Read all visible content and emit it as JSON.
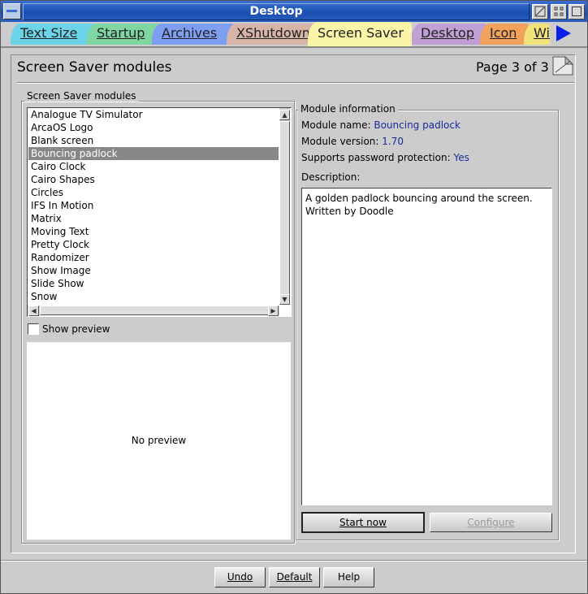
{
  "window": {
    "title": "Desktop"
  },
  "tabs": [
    {
      "label": "Text Size",
      "color": "#6bd4e8"
    },
    {
      "label": "Startup",
      "color": "#7fd6a2"
    },
    {
      "label": "Archives",
      "color": "#7e9ef2"
    },
    {
      "label": "XShutdown",
      "color": "#d8b4a8"
    },
    {
      "label": "Screen Saver",
      "color": "#fbf5a8"
    },
    {
      "label": "Desktop",
      "color": "#c0a0d4"
    },
    {
      "label": "Icon",
      "color": "#f2a25a"
    },
    {
      "label": "Wi",
      "color": "#f2e27a"
    }
  ],
  "page": {
    "title": "Screen Saver modules",
    "page_indicator": "Page 3 of 3"
  },
  "modules_group": {
    "label": "Screen Saver modules",
    "items": [
      "Analogue TV Simulator",
      "ArcaOS Logo",
      "Blank screen",
      "Bouncing padlock",
      "Cairo Clock",
      "Cairo Shapes",
      "Circles",
      "IFS In Motion",
      "Matrix",
      "Moving Text",
      "Pretty Clock",
      "Randomizer",
      "Show Image",
      "Slide Show",
      "Snow"
    ],
    "selected": "Bouncing padlock",
    "show_preview_label": "Show preview",
    "preview_text": "No preview"
  },
  "module_info": {
    "label": "Module information",
    "name_label": "Module name:",
    "name_value": "Bouncing padlock",
    "version_label": "Module version:",
    "version_value": "1.70",
    "password_label": "Supports password protection:",
    "password_value": "Yes",
    "description_label": "Description:",
    "description_line1": "A golden padlock bouncing around the screen.",
    "description_line2": "Written by Doodle",
    "start_now": "Start now",
    "configure": "Configure"
  },
  "footer": {
    "undo": "Undo",
    "default": "Default",
    "help": "Help"
  }
}
